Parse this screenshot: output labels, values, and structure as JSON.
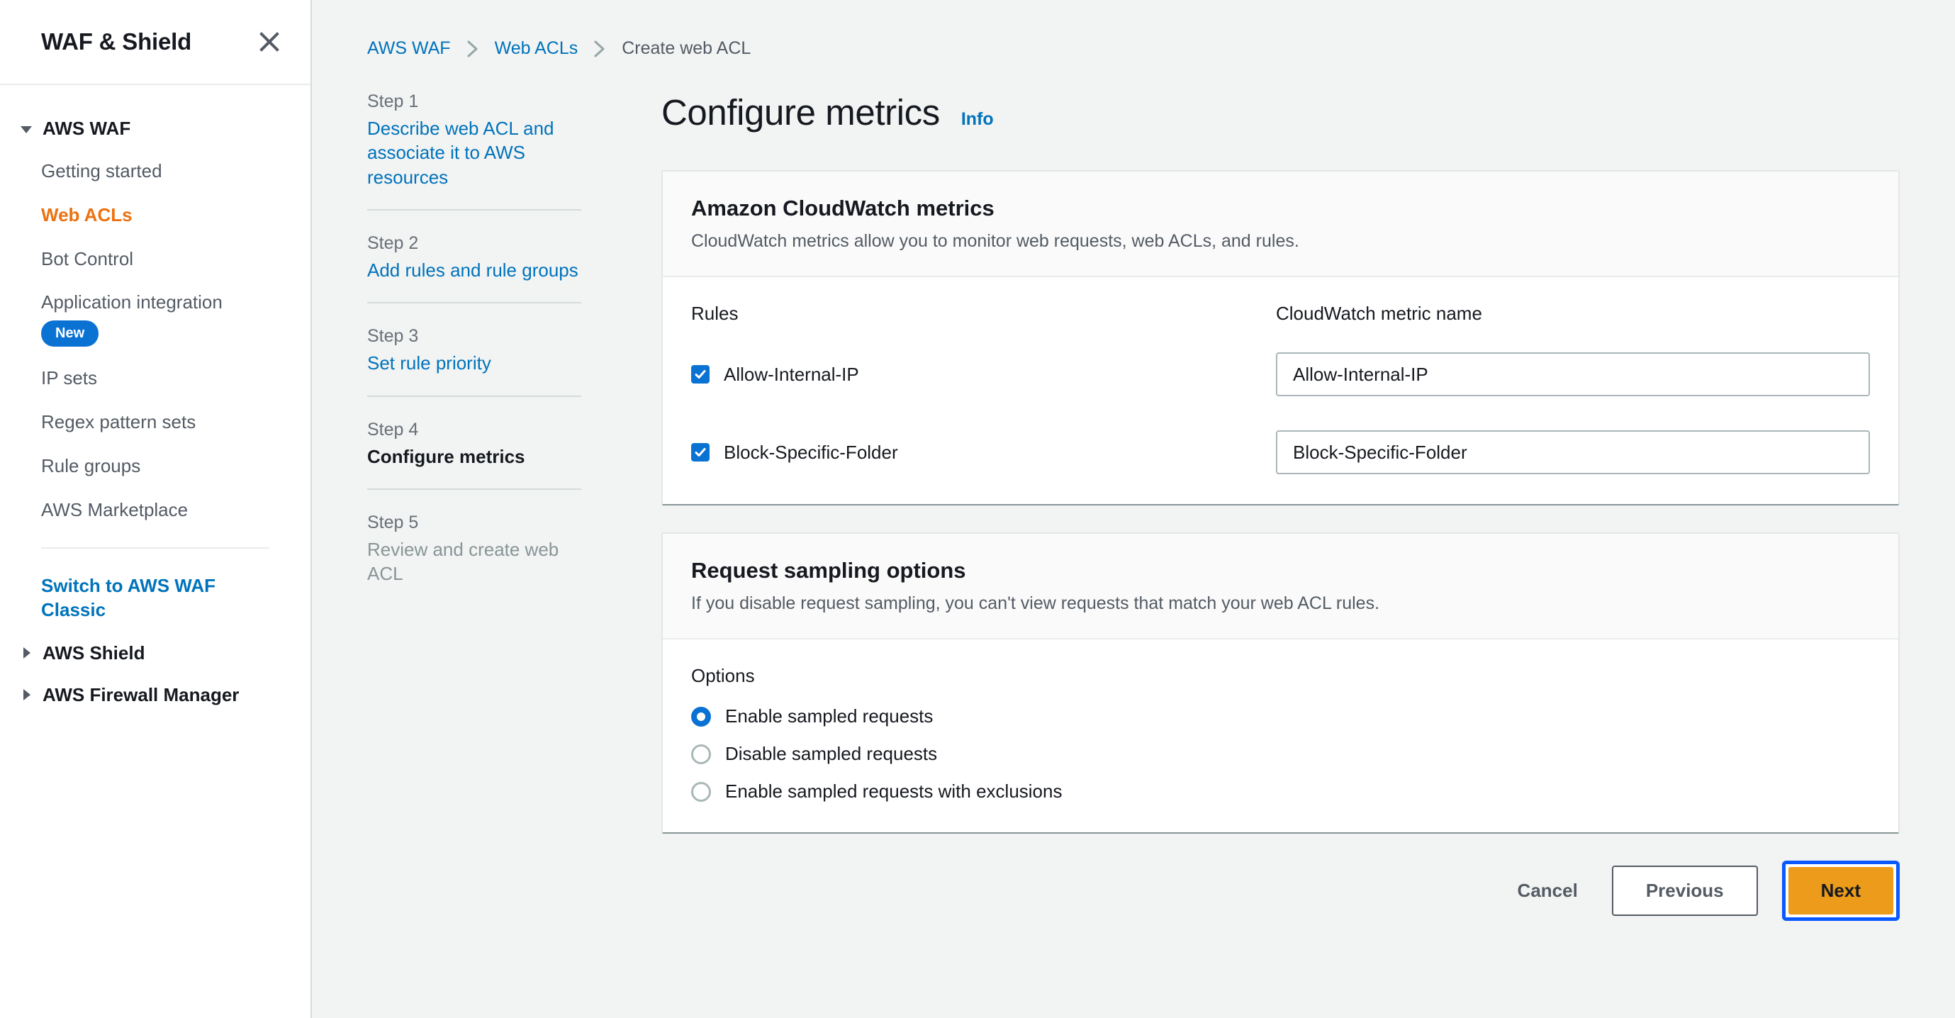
{
  "sidebar": {
    "title": "WAF & Shield",
    "close_icon": "close-icon",
    "groups": [
      {
        "label": "AWS WAF",
        "expanded": true,
        "caret_icon": "caret-down-icon",
        "items": [
          {
            "label": "Getting started",
            "state": "normal"
          },
          {
            "label": "Web ACLs",
            "state": "active"
          },
          {
            "label": "Bot Control",
            "state": "normal"
          },
          {
            "label": "Application integration",
            "state": "normal",
            "badge": "New"
          },
          {
            "label": "IP sets",
            "state": "normal"
          },
          {
            "label": "Regex pattern sets",
            "state": "normal"
          },
          {
            "label": "Rule groups",
            "state": "normal"
          },
          {
            "label": "AWS Marketplace",
            "state": "normal"
          }
        ]
      }
    ],
    "switch_link": "Switch to AWS WAF Classic",
    "collapsed_groups": [
      {
        "label": "AWS Shield",
        "caret_icon": "caret-right-icon"
      },
      {
        "label": "AWS Firewall Manager",
        "caret_icon": "caret-right-icon"
      }
    ]
  },
  "breadcrumb": {
    "items": [
      {
        "label": "AWS WAF",
        "type": "link"
      },
      {
        "label": "Web ACLs",
        "type": "link"
      },
      {
        "label": "Create web ACL",
        "type": "current"
      }
    ],
    "separator_icon": "chevron-right-icon"
  },
  "steps": [
    {
      "num": "Step 1",
      "name": "Describe web ACL and associate it to AWS resources",
      "state": "link"
    },
    {
      "num": "Step 2",
      "name": "Add rules and rule groups",
      "state": "link"
    },
    {
      "num": "Step 3",
      "name": "Set rule priority",
      "state": "link"
    },
    {
      "num": "Step 4",
      "name": "Configure metrics",
      "state": "current"
    },
    {
      "num": "Step 5",
      "name": "Review and create web ACL",
      "state": "future"
    }
  ],
  "page": {
    "title": "Configure metrics",
    "info_label": "Info"
  },
  "cloudwatch_card": {
    "title": "Amazon CloudWatch metrics",
    "description": "CloudWatch metrics allow you to monitor web requests, web ACLs, and rules.",
    "col_rules_header": "Rules",
    "col_metric_header": "CloudWatch metric name",
    "rows": [
      {
        "rule_label": "Allow-Internal-IP",
        "checked": true,
        "metric_name": "Allow-Internal-IP"
      },
      {
        "rule_label": "Block-Specific-Folder",
        "checked": true,
        "metric_name": "Block-Specific-Folder"
      }
    ]
  },
  "sampling_card": {
    "title": "Request sampling options",
    "description": "If you disable request sampling, you can't view requests that match your web ACL rules.",
    "options_label": "Options",
    "options": [
      {
        "label": "Enable sampled requests",
        "selected": true
      },
      {
        "label": "Disable sampled requests",
        "selected": false
      },
      {
        "label": "Enable sampled requests with exclusions",
        "selected": false
      }
    ]
  },
  "actions": {
    "cancel_label": "Cancel",
    "previous_label": "Previous",
    "next_label": "Next",
    "next_focus_color": "#0a58ff",
    "next_bg_color": "#ec9b1b"
  },
  "colors": {
    "accent_orange": "#ec7211",
    "link_blue": "#0073bb",
    "badge_blue": "#0972d3",
    "page_bg": "#f2f3f3"
  }
}
